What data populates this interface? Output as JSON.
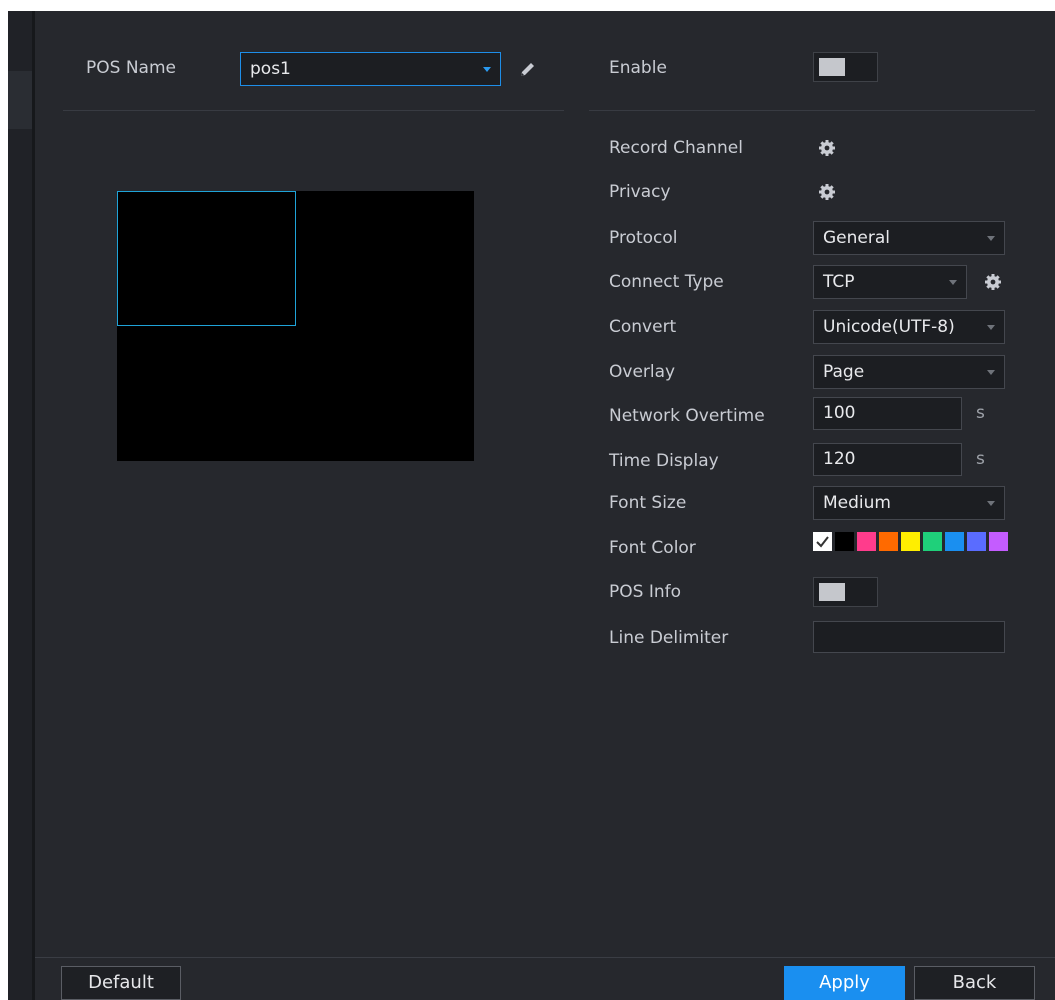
{
  "pos": {
    "name_label": "POS Name",
    "name_value": "pos1",
    "enable_label": "Enable",
    "enable_on": false
  },
  "settings": {
    "record_channel_label": "Record Channel",
    "privacy_label": "Privacy",
    "protocol_label": "Protocol",
    "protocol_value": "General",
    "connect_type_label": "Connect Type",
    "connect_type_value": "TCP",
    "convert_label": "Convert",
    "convert_value": "Unicode(UTF-8)",
    "overlay_label": "Overlay",
    "overlay_value": "Page",
    "network_overtime_label": "Network Overtime",
    "network_overtime_value": "100",
    "network_overtime_unit": "s",
    "time_display_label": "Time Display",
    "time_display_value": "120",
    "time_display_unit": "s",
    "font_size_label": "Font Size",
    "font_size_value": "Medium",
    "font_color_label": "Font Color",
    "font_colors": [
      "#ffffff",
      "#000000",
      "#ff3c8c",
      "#ff6a00",
      "#ffee00",
      "#1fd07a",
      "#1a8ff0",
      "#5a6cff",
      "#c45cff"
    ],
    "pos_info_label": "POS Info",
    "pos_info_on": false,
    "line_delimiter_label": "Line Delimiter",
    "line_delimiter_value": ""
  },
  "footer": {
    "default_label": "Default",
    "apply_label": "Apply",
    "back_label": "Back"
  },
  "icons": {
    "edit": "pencil-icon",
    "settings": "gear-icon",
    "dropdown": "chevron-down-icon",
    "checkmark": "check-icon"
  },
  "colors": {
    "background": "#26282d",
    "accent": "#1a8ff0",
    "region_border": "#1fa3d8"
  }
}
